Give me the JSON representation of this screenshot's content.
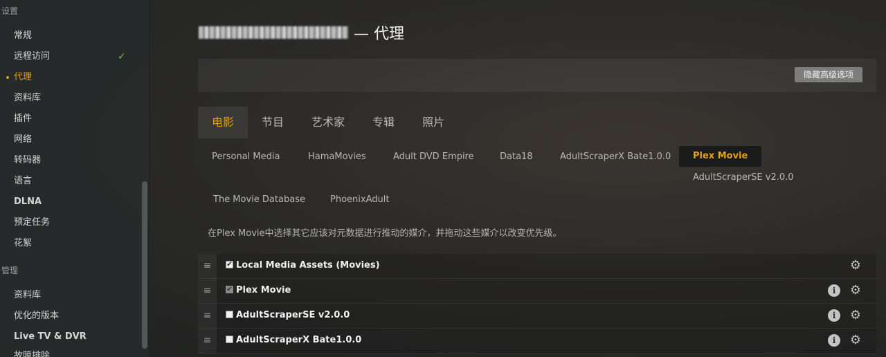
{
  "sidebar": {
    "sections": [
      {
        "title": "设置"
      },
      {
        "title": "管理"
      }
    ],
    "settings_items": [
      {
        "label": "常规"
      },
      {
        "label": "远程访问",
        "check": "✓"
      },
      {
        "label": "代理",
        "active": true
      },
      {
        "label": "资料库"
      },
      {
        "label": "插件"
      },
      {
        "label": "网络"
      },
      {
        "label": "转码器"
      },
      {
        "label": "语言"
      },
      {
        "label": "DLNA"
      },
      {
        "label": "预定任务"
      },
      {
        "label": "花絮"
      }
    ],
    "manage_items": [
      {
        "label": "资料库"
      },
      {
        "label": "优化的版本"
      },
      {
        "label": "Live TV & DVR"
      },
      {
        "label": "故障排除"
      }
    ]
  },
  "header": {
    "title_suffix": "— 代理"
  },
  "advanced": {
    "button_label": "隐藏高级选项"
  },
  "media_tabs": [
    {
      "label": "电影",
      "active": true
    },
    {
      "label": "节目"
    },
    {
      "label": "艺术家"
    },
    {
      "label": "专辑"
    },
    {
      "label": "照片"
    }
  ],
  "agent_tabs": [
    {
      "label": "Personal Media"
    },
    {
      "label": "HamaMovies"
    },
    {
      "label": "Adult DVD Empire"
    },
    {
      "label": "Data18"
    },
    {
      "label": "AdultScraperX Bate1.0.0"
    },
    {
      "label": "Plex Movie",
      "active": true
    },
    {
      "label": "AdultScraperSE v2.0.0"
    },
    {
      "label": "The Movie Database"
    },
    {
      "label": "PhoenixAdult"
    }
  ],
  "description": "在Plex Movie中选择其它应该对元数据进行推动的媒介，并拖动这些媒介以改变优先级。",
  "agents": [
    {
      "label": "Local Media Assets (Movies)",
      "checked": true,
      "info": false
    },
    {
      "label": "Plex Movie",
      "checked": true,
      "disabled": true,
      "info": true
    },
    {
      "label": "AdultScraperSE v2.0.0",
      "checked": false,
      "info": true
    },
    {
      "label": "AdultScraperX Bate1.0.0",
      "checked": false,
      "info": true
    }
  ],
  "icons": {
    "handle": "≡",
    "check": "✔",
    "info": "i",
    "gear": "⚙"
  },
  "colors": {
    "accent": "#e5a00d",
    "success": "#6fbf44"
  }
}
